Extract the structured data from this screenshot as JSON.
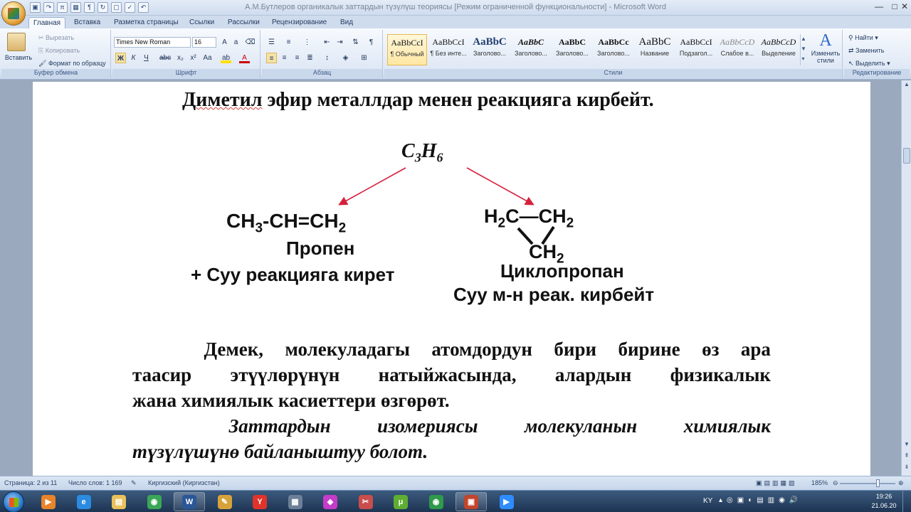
{
  "window": {
    "title": "А.М.Бутлеров органикалык заттардын түзүлүш теориясы [Режим ограниченной функциональности] - Microsoft Word",
    "controls": [
      "—",
      "□",
      "✕"
    ]
  },
  "tabs": [
    "Главная",
    "Вставка",
    "Разметка страницы",
    "Ссылки",
    "Рассылки",
    "Рецензирование",
    "Вид"
  ],
  "ribbon": {
    "clipboard": {
      "paste": "Вставить",
      "cut": "Вырезать",
      "copy": "Копировать",
      "format_painter": "Формат по образцу",
      "label": "Буфер обмена"
    },
    "font": {
      "name": "Times New Roman",
      "size": "16",
      "label": "Шрифт",
      "bold": "Ж",
      "italic": "К",
      "underline": "Ч"
    },
    "paragraph": {
      "label": "Абзац"
    },
    "styles": {
      "label": "Стили",
      "items": [
        {
          "preview": "AaBbCcI",
          "name": "¶ Обычный"
        },
        {
          "preview": "AaBbCcI",
          "name": "¶ Без инте..."
        },
        {
          "preview": "AaBbC",
          "name": "Заголово..."
        },
        {
          "preview": "AaBbC",
          "name": "Заголово..."
        },
        {
          "preview": "AaBbC",
          "name": "Заголово..."
        },
        {
          "preview": "AaBbCc",
          "name": "Заголово..."
        },
        {
          "preview": "AaBbC",
          "name": "Название"
        },
        {
          "preview": "AaBbCcI",
          "name": "Подзагол..."
        },
        {
          "preview": "AaBbCcD",
          "name": "Слабое в..."
        },
        {
          "preview": "AaBbCcD",
          "name": "Выделение"
        }
      ],
      "change": "Изменить стили"
    },
    "editing": {
      "find": "Найти",
      "replace": "Заменить",
      "select": "Выделить",
      "label": "Редактирование"
    }
  },
  "document": {
    "heading": {
      "wavy": "Диметил",
      "rest": " эфир металлдар менен реакцияга кирбейт."
    },
    "top_formula": {
      "main": "C",
      "sub1": "3",
      "h": "H",
      "sub2": "6"
    },
    "propene": {
      "formula": {
        "a": "CH",
        "sub": "3",
        "b": "-CH=CH",
        "sub2": "2"
      },
      "name": "Пропен",
      "note": "+ Суу реакцияга кирет"
    },
    "cyclopropane": {
      "left": {
        "a": "H",
        "sub": "2",
        "b": "C"
      },
      "dash": "—",
      "right": {
        "a": "CH",
        "sub": "2"
      },
      "bottom": {
        "a": "CH",
        "sub": "2"
      },
      "name": "Циклопропан",
      "note": "Суу м-н реак. кирбейт"
    },
    "paragraph1": {
      "line1_words": [
        "Демек,",
        "молекуладагы",
        "атомдордун",
        "бири",
        "бирине",
        "өз",
        "ара"
      ],
      "line2_words": [
        "таасир",
        "этүүлөрүнүн",
        "натыйжасында,",
        "алардын",
        "физикалык"
      ],
      "line3": "жана химиялык касиеттери өзгөрөт."
    },
    "paragraph2": {
      "line1_words": [
        "Заттардын",
        "изомериясы",
        "молекуланын",
        "химиялык"
      ],
      "line2": "түзүлүшүнө байланыштуу болот."
    }
  },
  "statusbar": {
    "page": "Страница: 2 из 11",
    "words": "Число слов: 1 169",
    "language": "Киргизский (Киргизстан)",
    "zoom": "185%",
    "zoom_level": 0.69
  },
  "taskbar": {
    "apps": [
      {
        "name": "media-player",
        "glyph": "▶",
        "color": "#e8842a"
      },
      {
        "name": "ie",
        "glyph": "e",
        "color": "#2a8be0"
      },
      {
        "name": "explorer",
        "glyph": "▤",
        "color": "#e9c15a"
      },
      {
        "name": "chrome",
        "glyph": "◉",
        "color": "#3aa757"
      },
      {
        "name": "word",
        "glyph": "W",
        "color": "#2b5797"
      },
      {
        "name": "paint",
        "glyph": "✎",
        "color": "#d8a23a"
      },
      {
        "name": "yandex",
        "glyph": "Y",
        "color": "#e0332b"
      },
      {
        "name": "calculator",
        "glyph": "▦",
        "color": "#6b7f99"
      },
      {
        "name": "gem-app",
        "glyph": "◆",
        "color": "#c43cc8"
      },
      {
        "name": "snipping",
        "glyph": "✂",
        "color": "#c94d4d"
      },
      {
        "name": "utorrent",
        "glyph": "μ",
        "color": "#5fae31"
      },
      {
        "name": "chrome-2",
        "glyph": "◉",
        "color": "#2e9a4a"
      },
      {
        "name": "presentation",
        "glyph": "▣",
        "color": "#c2452d"
      },
      {
        "name": "zoom",
        "glyph": "▶",
        "color": "#2d8cff"
      }
    ],
    "lang": "KY",
    "time": "19:26",
    "date": "21.06.20"
  },
  "colors": {
    "arrow": "#d6213b",
    "accent": "#2b579a"
  }
}
